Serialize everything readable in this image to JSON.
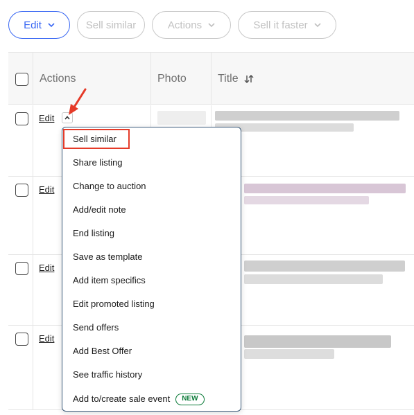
{
  "toolbar": {
    "edit_label": "Edit",
    "sell_similar_label": "Sell similar",
    "actions_label": "Actions",
    "sell_faster_label": "Sell it faster"
  },
  "table": {
    "headers": {
      "actions": "Actions",
      "photo": "Photo",
      "title": "Title",
      "title_sort_icon": "sort-icon"
    },
    "rows": [
      {
        "edit_label": "Edit"
      },
      {
        "edit_label": "Edit"
      },
      {
        "edit_label": "Edit"
      },
      {
        "edit_label": "Edit"
      }
    ]
  },
  "menu": {
    "items": [
      {
        "label": "Sell similar"
      },
      {
        "label": "Share listing"
      },
      {
        "label": "Change to auction"
      },
      {
        "label": "Add/edit note"
      },
      {
        "label": "End listing"
      },
      {
        "label": "Save as template"
      },
      {
        "label": "Add item specifics"
      },
      {
        "label": "Edit promoted listing"
      },
      {
        "label": "Send offers"
      },
      {
        "label": "Add Best Offer"
      },
      {
        "label": "See traffic history"
      },
      {
        "label": "Add to/create sale event",
        "badge": "NEW"
      }
    ]
  },
  "colors": {
    "accent": "#3665f3",
    "highlight": "#e53a28",
    "badge": "#0a7a38"
  }
}
